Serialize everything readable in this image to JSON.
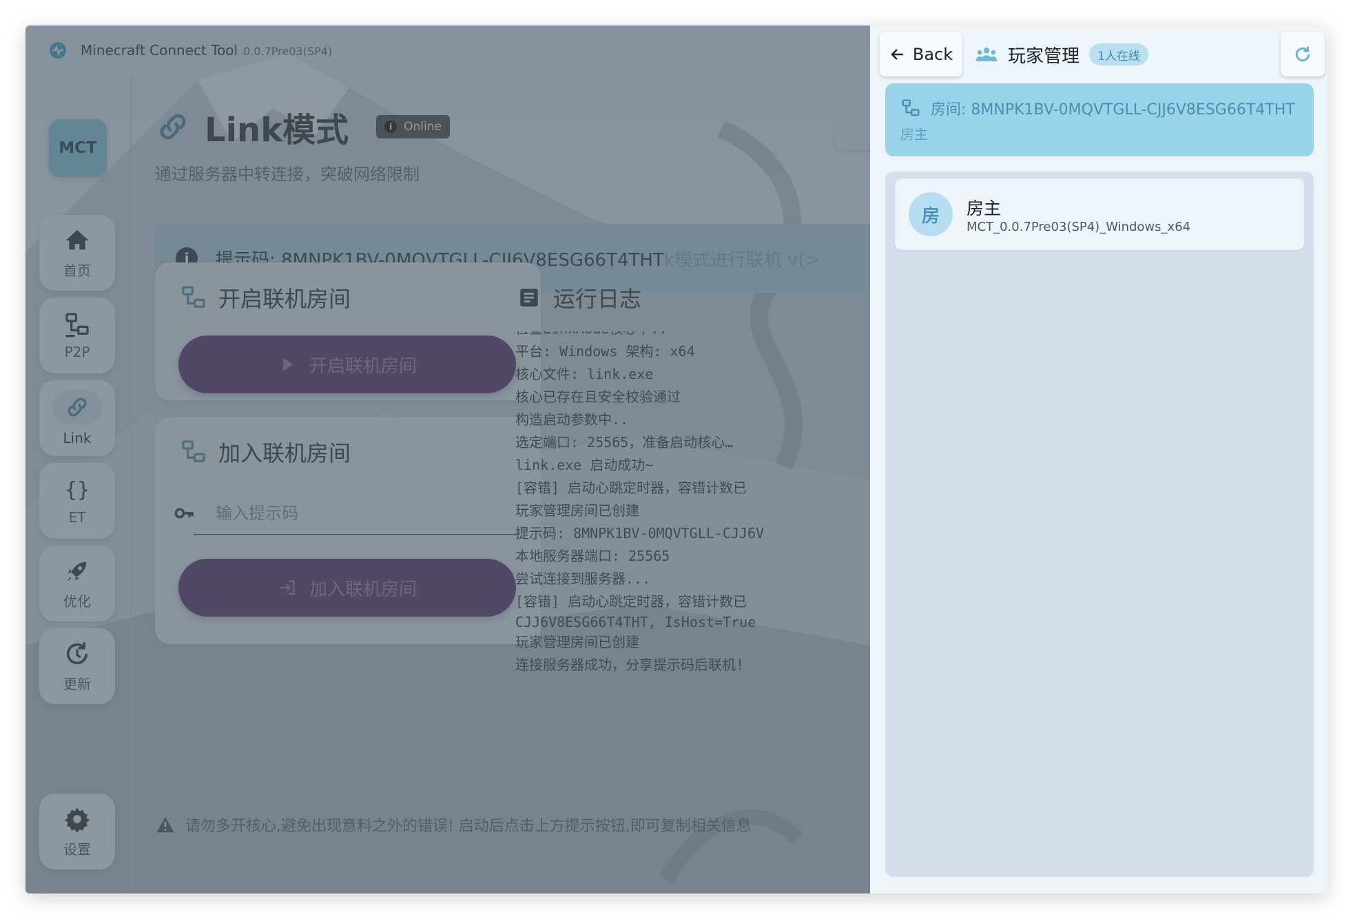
{
  "app": {
    "name": "Minecraft Connect Tool",
    "version": "0.0.7Pre03(SP4)"
  },
  "sidebar": {
    "logo": "MCT",
    "items": [
      {
        "label": "首页",
        "icon": "home-icon"
      },
      {
        "label": "P2P",
        "icon": "network-icon"
      },
      {
        "label": "Link",
        "icon": "link-icon"
      },
      {
        "label": "ET",
        "icon": "braces-icon"
      },
      {
        "label": "优化",
        "icon": "rocket-icon"
      },
      {
        "label": "更新",
        "icon": "update-icon"
      }
    ],
    "settings_label": "设置"
  },
  "main": {
    "title": "Link模式",
    "status": "Online",
    "subtitle": "通过服务器中转连接，突破网络限制",
    "hint": "提示码: 8MNPK1BV-0MQVTGLL-CJJ6V8ESG66T4THT",
    "hint_trailing": "k模式进行联机 v(>",
    "host_card": {
      "title": "开启联机房间",
      "button": "开启联机房间"
    },
    "join_card": {
      "title": "加入联机房间",
      "placeholder": "输入提示码",
      "button": "加入联机房间"
    },
    "log": {
      "title": "运行日志",
      "lines": [
        "检查LinkMode核心中..",
        "平台: Windows 架构: x64",
        "核心文件: link.exe",
        "核心已存在且安全校验通过",
        "构造启动参数中..",
        "选定端口: 25565，准备启动核心…",
        "link.exe 启动成功~",
        "[容错] 启动心跳定时器，容错计数已",
        "玩家管理房间已创建",
        "提示码: 8MNPK1BV-0MQVTGLL-CJJ6V",
        "本地服务器端口: 25565",
        "尝试连接到服务器...",
        "[容错] 启动心跳定时器，容错计数已",
        "CJJ6V8ESG66T4THT, IsHost=True",
        "玩家管理房间已创建",
        "连接服务器成功，分享提示码后联机!"
      ]
    },
    "footer_warning": "请勿多开核心,避免出现意料之外的错误! 启动后点击上方提示按钮,即可复制相关信息"
  },
  "drawer": {
    "back_label": "Back",
    "title": "玩家管理",
    "online_count": "1人在线",
    "room": {
      "label": "房间: 8MNPK1BV-0MQVTGLL-CJJ6V8ESG66T4THT",
      "role": "房主"
    },
    "players": [
      {
        "avatar": "房",
        "name": "房主",
        "client": "MCT_0.0.7Pre03(SP4)_Windows_x64"
      }
    ]
  },
  "colors": {
    "accent_purple": "#5b3370",
    "sidebar_logo": "#87c9e1",
    "room_banner": "#99d3ea",
    "online_chip_text": "#3e8eb0"
  }
}
